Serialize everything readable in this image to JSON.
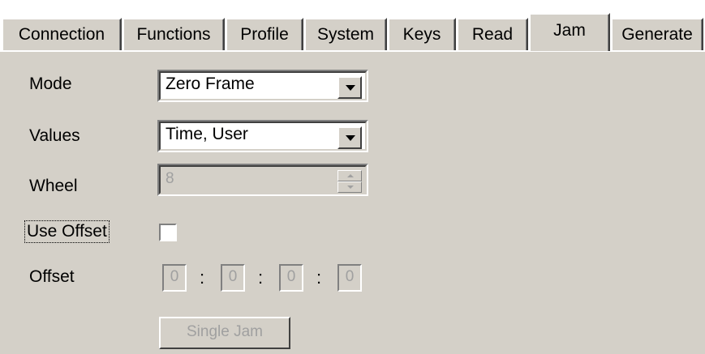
{
  "tabs": [
    {
      "label": "Connection"
    },
    {
      "label": "Functions"
    },
    {
      "label": "Profile"
    },
    {
      "label": "System"
    },
    {
      "label": "Keys"
    },
    {
      "label": "Read"
    },
    {
      "label": "Jam"
    },
    {
      "label": "Generate"
    }
  ],
  "active_tab": "Jam",
  "form": {
    "mode_label": "Mode",
    "mode_value": "Zero Frame",
    "values_label": "Values",
    "values_value": "Time, User",
    "wheel_label": "Wheel",
    "wheel_value": "8",
    "use_offset_label": "Use Offset",
    "use_offset_checked": false,
    "offset_label": "Offset",
    "offset_values": [
      "0",
      "0",
      "0",
      "0"
    ],
    "offset_separator": ":",
    "single_jam_label": "Single Jam"
  },
  "colors": {
    "panel_bg": "#d4d0c8",
    "disabled_text": "#a0a0a0"
  },
  "icons": {
    "combo_arrow": "chevron-down-icon",
    "spin_up": "spin-up-icon",
    "spin_down": "spin-down-icon"
  }
}
